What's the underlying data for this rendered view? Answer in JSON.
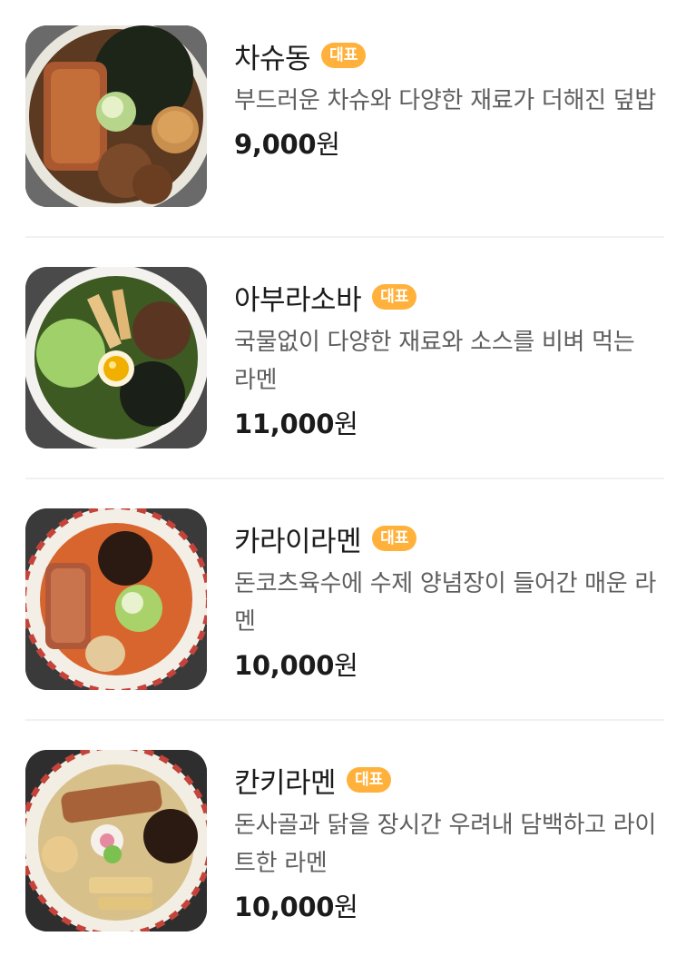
{
  "menu": {
    "items": [
      {
        "name": "차슈동",
        "badge": "대표",
        "description": "부드러운 차슈와 다양한 재료가 더해진 덮밥",
        "price": "9,000",
        "currency": "원",
        "image_icon": "chashu-don-photo"
      },
      {
        "name": "아부라소바",
        "badge": "대표",
        "description": "국물없이 다양한 재료와 소스를 비벼 먹는 라멘",
        "price": "11,000",
        "currency": "원",
        "image_icon": "abura-soba-photo"
      },
      {
        "name": "카라이라멘",
        "badge": "대표",
        "description": "돈코츠육수에 수제 양념장이 들어간 매운 라멘",
        "price": "10,000",
        "currency": "원",
        "image_icon": "karai-ramen-photo"
      },
      {
        "name": "칸키라멘",
        "badge": "대표",
        "description": "돈사골과 닭을 장시간 우려내 담백하고 라이트한 라멘",
        "price": "10,000",
        "currency": "원",
        "image_icon": "kanki-ramen-photo"
      }
    ],
    "badge_color": "#ffb13b"
  }
}
